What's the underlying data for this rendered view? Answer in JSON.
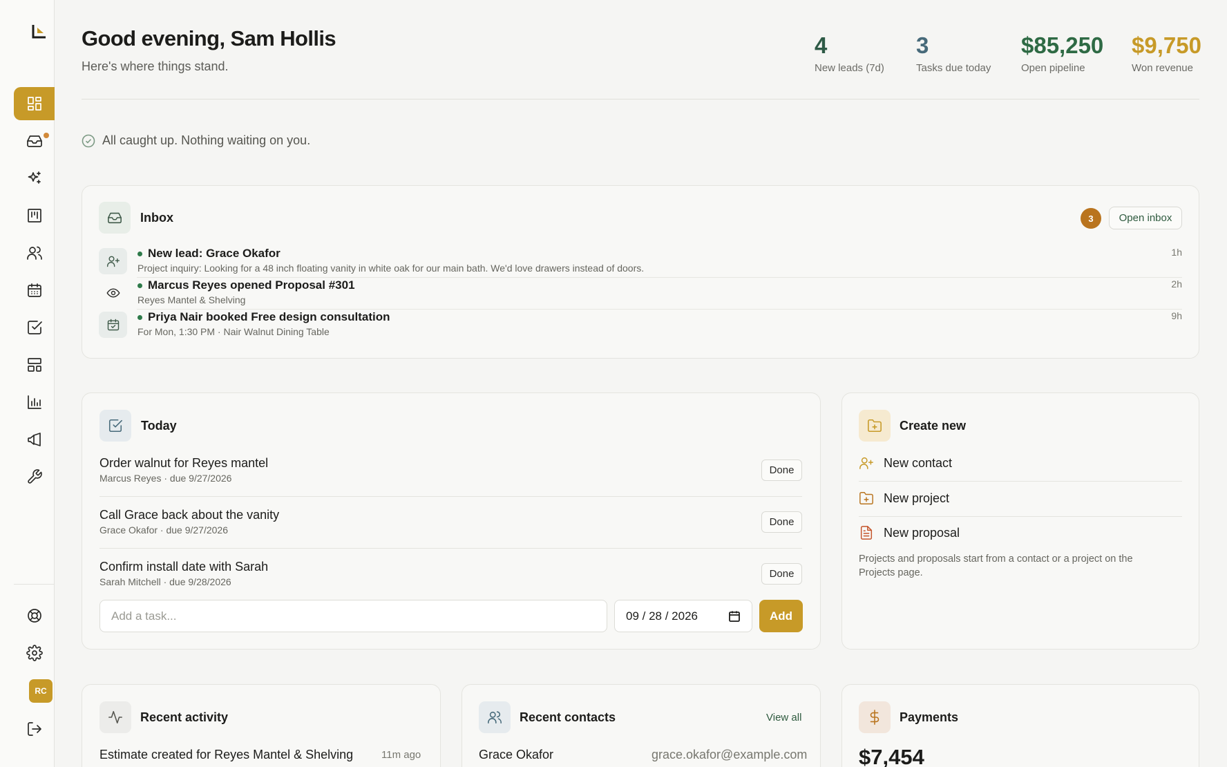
{
  "header": {
    "greeting": "Good evening, Sam Hollis",
    "subtitle": "Here's where things stand."
  },
  "stats": [
    {
      "value": "4",
      "label": "New leads (7d)",
      "color": "#2e5a46"
    },
    {
      "value": "3",
      "label": "Tasks due today",
      "color": "#476a7a"
    },
    {
      "value": "$85,250",
      "label": "Open pipeline",
      "color": "#2e6a44"
    },
    {
      "value": "$9,750",
      "label": "Won revenue",
      "color": "#c79a28"
    }
  ],
  "status_message": "All caught up. Nothing waiting on you.",
  "inbox": {
    "title": "Inbox",
    "count": "3",
    "open_label": "Open inbox",
    "items": [
      {
        "icon": "user-plus-icon",
        "title": "New lead: Grace Okafor",
        "subtitle": "Project inquiry: Looking for a 48 inch floating vanity in white oak for our main bath. We'd love drawers instead of doors.",
        "time": "1h"
      },
      {
        "icon": "eye-icon",
        "title": "Marcus Reyes opened Proposal #301",
        "subtitle": "Reyes Mantel & Shelving",
        "time": "2h"
      },
      {
        "icon": "calendar-icon",
        "title": "Priya Nair booked Free design consultation",
        "subtitle": "For Mon, 1:30 PM · Nair Walnut Dining Table",
        "time": "9h"
      }
    ]
  },
  "today": {
    "title": "Today",
    "done_label": "Done",
    "tasks": [
      {
        "title": "Order walnut for Reyes mantel",
        "subtitle": "Marcus Reyes · due 9/27/2026"
      },
      {
        "title": "Call Grace back about the vanity",
        "subtitle": "Grace Okafor · due 9/27/2026"
      },
      {
        "title": "Confirm install date with Sarah",
        "subtitle": "Sarah Mitchell · due 9/28/2026"
      }
    ],
    "input_placeholder": "Add a task...",
    "date_value": "09 / 28 / 2026",
    "add_label": "Add"
  },
  "create_new": {
    "title": "Create new",
    "items": [
      {
        "icon": "user-plus-icon",
        "label": "New contact"
      },
      {
        "icon": "folder-plus-icon",
        "label": "New project"
      },
      {
        "icon": "file-text-icon",
        "label": "New proposal"
      }
    ],
    "note": "Projects and proposals start from a contact or a project on the Projects page."
  },
  "recent_activity": {
    "title": "Recent activity",
    "items": [
      {
        "text": "Estimate created for Reyes Mantel & Shelving",
        "time": "11m ago"
      }
    ]
  },
  "recent_contacts": {
    "title": "Recent contacts",
    "view_all": "View all",
    "items": [
      {
        "name": "Grace Okafor",
        "email": "grace.okafor@example.com"
      }
    ]
  },
  "payments": {
    "title": "Payments",
    "amount": "$7,454"
  },
  "sidebar": {
    "avatar_initials": "RC",
    "accent": "#c79a28",
    "nav": [
      "dashboard-icon",
      "inbox-icon",
      "sparkles-icon",
      "kanban-icon",
      "users-icon",
      "calendar-icon",
      "check-square-icon",
      "layout-icon",
      "bar-chart-icon",
      "megaphone-icon",
      "wrench-icon"
    ],
    "bottom": [
      "help-icon",
      "settings-icon",
      "logout-icon"
    ]
  }
}
